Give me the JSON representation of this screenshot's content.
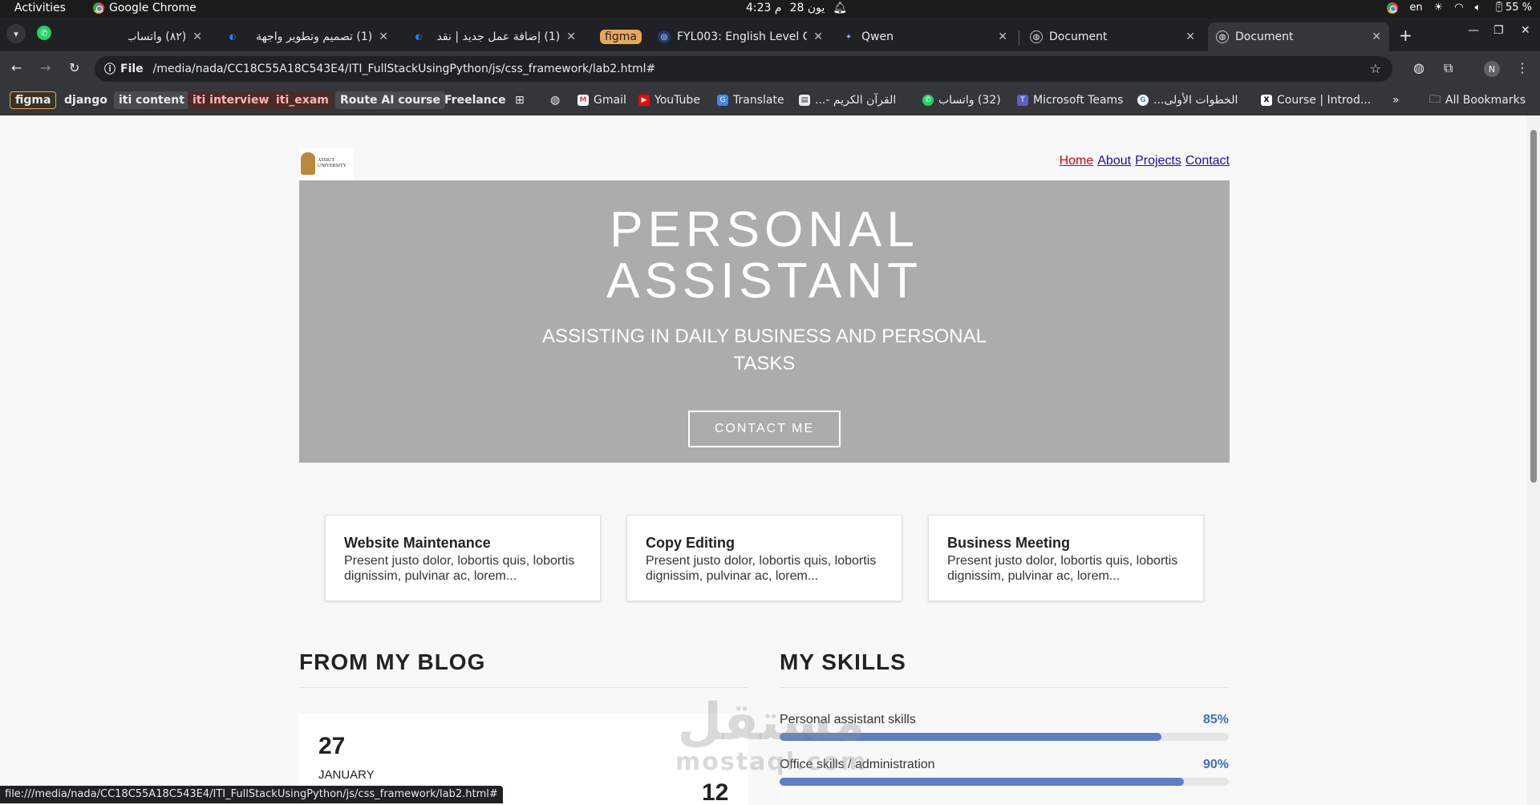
{
  "system": {
    "activities": "Activities",
    "app_name": "Google Chrome",
    "date": "28 يون",
    "time": "4:23 م",
    "lang": "en",
    "battery": "55 %"
  },
  "tabs": [
    {
      "title": "(٨٢) واتساب",
      "active": false
    },
    {
      "title": "(1) تصميم وتطوير واجهة",
      "active": false
    },
    {
      "title": "(1) إضافة عمل جديد | نقد",
      "active": false
    },
    {
      "title": "figma",
      "active": false
    },
    {
      "title": "FYL003: English Level G",
      "active": false
    },
    {
      "title": "Qwen",
      "active": false
    },
    {
      "title": "Document",
      "active": false
    },
    {
      "title": "Document",
      "active": true
    }
  ],
  "toolbar": {
    "site_info": "File",
    "url": "/media/nada/CC18C55A18C543E4/ITI_FullStackUsingPython/js/css_framework/lab2.html#",
    "avatar_letter": "N"
  },
  "bookmarks": {
    "figma": "figma",
    "django": "django",
    "iti_content": "iti content",
    "iti_interview": "iti interview",
    "iti_exam": "iti_exam",
    "route_ai": "Route AI course",
    "freelance": "Freelance",
    "gmail": "Gmail",
    "youtube": "YouTube",
    "translate": "Translate",
    "quran": "القرآن الكريم -...",
    "whatsapp": "(32) واتساب",
    "teams": "Microsoft Teams",
    "first_steps": "الخطوات الأولى...",
    "course": "Course | Introd...",
    "overflow": "»",
    "all_bookmarks": "All Bookmarks"
  },
  "page": {
    "logo_text_1": "ASSIUT",
    "logo_text_2": "UNIVERSITY",
    "nav": [
      "Home",
      "About",
      "Projects",
      "Contact"
    ],
    "hero": {
      "title_line1": "PERSONAL",
      "title_line2": "ASSISTANT",
      "subtitle_line1": "ASSISTING IN DAILY BUSINESS AND PERSONAL",
      "subtitle_line2": "TASKS",
      "cta": "CONTACT ME"
    },
    "services": [
      {
        "title": "Website Maintenance",
        "text": "Present justo dolor, lobortis quis, lobortis dignissim, pulvinar ac, lorem..."
      },
      {
        "title": "Copy Editing",
        "text": "Present justo dolor, lobortis quis, lobortis dignissim, pulvinar ac, lorem..."
      },
      {
        "title": "Business Meeting",
        "text": "Present justo dolor, lobortis quis, lobortis dignissim, pulvinar ac, lorem..."
      }
    ],
    "blog": {
      "heading": "FROM MY BLOG",
      "day": "27",
      "month": "JANUARY",
      "day2": "12"
    },
    "skills": {
      "heading": "MY SKILLS",
      "items": [
        {
          "name": "Personal assistant skills",
          "percent_label": "85%",
          "value": 0.85
        },
        {
          "name": "Office skills / administration",
          "percent_label": "90%",
          "value": 0.9
        }
      ]
    },
    "watermark_ar": "مستقل",
    "watermark_lat": "mostaql.com"
  },
  "status_bar": {
    "url": "file:///media/nada/CC18C55A18C543E4/ITI_FullStackUsingPython/js/css_framework/lab2.html#"
  },
  "colors": {
    "hero_bg": "#acacac",
    "skill_fill": "#5b7ec6",
    "nav_current": "#d0021b",
    "nav_link": "#1a0dab"
  }
}
